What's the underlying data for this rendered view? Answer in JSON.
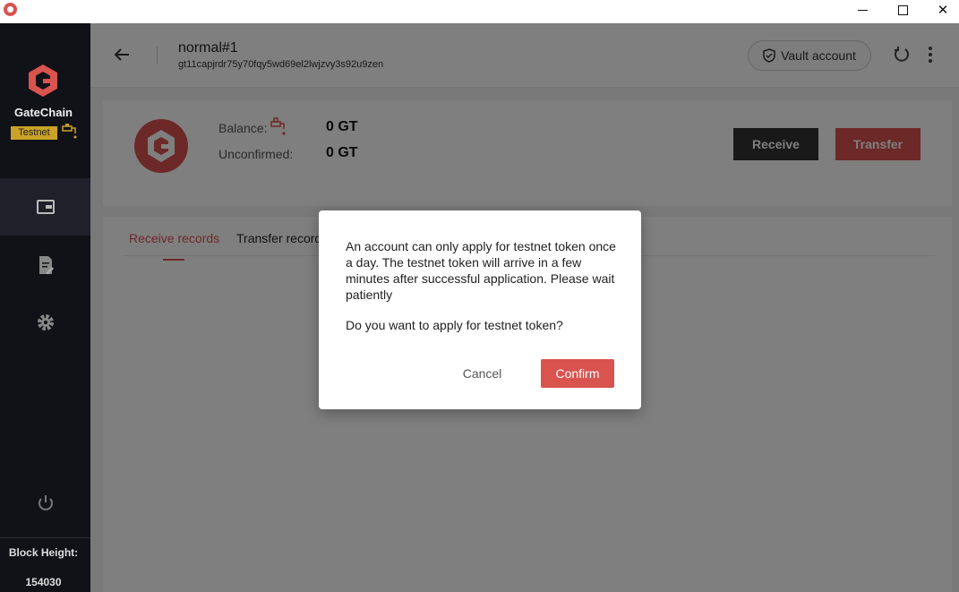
{
  "window": {
    "minimize_icon": "minimize-icon",
    "maximize_icon": "maximize-icon",
    "close_symbol": "✕"
  },
  "sidebar": {
    "brand": "GateChain",
    "network_badge": "Testnet",
    "block_height_label": "Block Height:",
    "block_height_value": "154030",
    "items": [
      {
        "name": "wallet",
        "icon": "wallet-icon"
      },
      {
        "name": "records",
        "icon": "document-edit-icon"
      },
      {
        "name": "settings",
        "icon": "gear-icon"
      }
    ]
  },
  "header": {
    "account_name": "normal#1",
    "account_address": "gt11capjrdr75y70fqy5wd69el2lwjzvy3s92u9zen",
    "vault_label": "Vault account"
  },
  "balance": {
    "balance_label": "Balance:",
    "balance_value": "0 GT",
    "unconfirmed_label": "Unconfirmed:",
    "unconfirmed_value": "0 GT",
    "receive_label": "Receive",
    "transfer_label": "Transfer"
  },
  "tabs": {
    "receive_records": "Receive records",
    "transfer_records": "Transfer records"
  },
  "dialog": {
    "message": "An account can only apply for testnet token once a day. The testnet token will arrive in a few minutes after successful application. Please wait patiently",
    "question": "Do you want to apply for testnet token?",
    "cancel_label": "Cancel",
    "confirm_label": "Confirm"
  },
  "colors": {
    "accent": "#d9534f",
    "sidebar_bg": "#111218",
    "badge": "#c9a227"
  }
}
